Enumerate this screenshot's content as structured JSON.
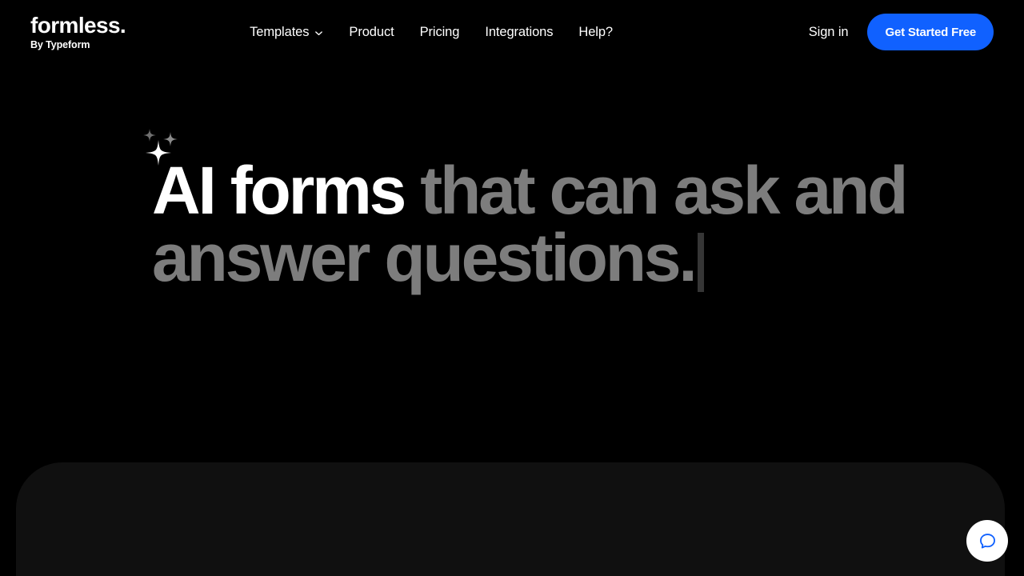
{
  "page": {
    "background_color": "#000000",
    "panel_color": "#101010"
  },
  "header": {
    "brand": {
      "name": "formless.",
      "subtitle": "By Typeform"
    },
    "nav": [
      {
        "label": "Templates",
        "has_dropdown": true,
        "icon": "chevron-down-icon"
      },
      {
        "label": "Product",
        "has_dropdown": false
      },
      {
        "label": "Pricing",
        "has_dropdown": false
      },
      {
        "label": "Integrations",
        "has_dropdown": false
      },
      {
        "label": "Help?",
        "has_dropdown": false
      }
    ],
    "sign_in_label": "Sign in",
    "cta_label": "Get Started Free",
    "cta_color": "#1061FF"
  },
  "hero": {
    "highlight_text": "AI forms",
    "rest_text": " that can ask and answer questions.",
    "highlight_color": "#ffffff",
    "rest_color": "#7d7d7d",
    "caret_color": "#363636",
    "sparkle_icon": "sparkles-icon"
  },
  "chat": {
    "icon": "chat-bubble-icon",
    "icon_color": "#1061FF",
    "background_color": "#ffffff"
  }
}
